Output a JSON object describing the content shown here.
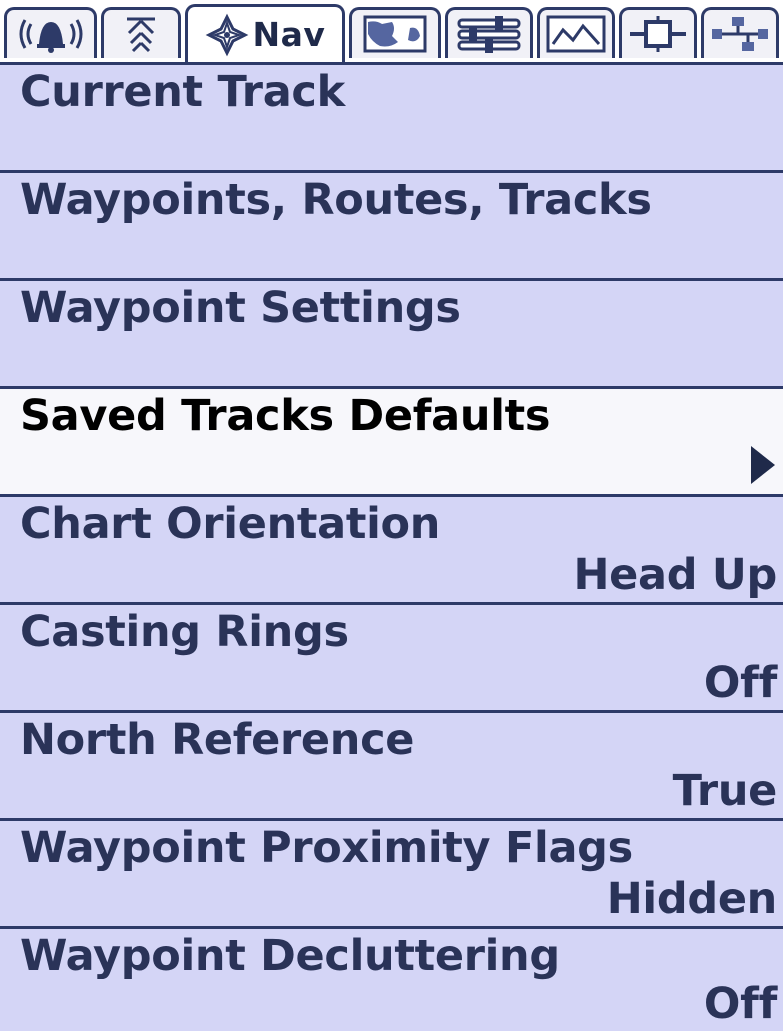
{
  "tabs": [
    {
      "id": "alarms",
      "icon": "alarm-icon",
      "label": ""
    },
    {
      "id": "sonar",
      "icon": "sonar-icon",
      "label": ""
    },
    {
      "id": "nav",
      "icon": "nav-compass-icon",
      "label": "Nav",
      "active": true
    },
    {
      "id": "chart",
      "icon": "chart-map-icon",
      "label": ""
    },
    {
      "id": "setup",
      "icon": "settings-sliders-icon",
      "label": ""
    },
    {
      "id": "views",
      "icon": "view-screen-icon",
      "label": ""
    },
    {
      "id": "accessories",
      "icon": "accessory-module-icon",
      "label": ""
    },
    {
      "id": "network",
      "icon": "network-icon",
      "label": ""
    }
  ],
  "menu": {
    "items": [
      {
        "label": "Current Track",
        "value": ""
      },
      {
        "label": "Waypoints, Routes, Tracks",
        "value": ""
      },
      {
        "label": "Waypoint Settings",
        "value": ""
      },
      {
        "label": "Saved Tracks Defaults",
        "value": "",
        "selected": true,
        "has_submenu": true
      },
      {
        "label": "Chart Orientation",
        "value": "Head Up"
      },
      {
        "label": "Casting Rings",
        "value": "Off"
      },
      {
        "label": "North Reference",
        "value": "True"
      },
      {
        "label": "Waypoint Proximity Flags",
        "value": "Hidden"
      },
      {
        "label": "Waypoint Decluttering",
        "value": "Off"
      }
    ]
  },
  "colors": {
    "item_background": "#d4d5f6",
    "item_selected_background": "#f7f7fb",
    "border": "#2d3a68",
    "text": "#2a3358"
  }
}
